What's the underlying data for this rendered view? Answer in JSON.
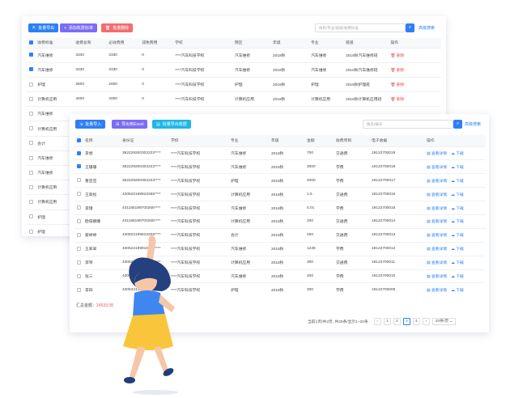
{
  "back": {
    "buttons": [
      "批量导出",
      "添加收费标准",
      "批量删除"
    ],
    "search_placeholder": "按校/专业/班级/收费标准",
    "advanced_search": "高级搜索",
    "columns": [
      "收费标准",
      "收费总和",
      "必收费用",
      "减免费用",
      "学校",
      "院区",
      "年级",
      "专业",
      "班级",
      "操作"
    ],
    "delete_label": "删除",
    "rows": [
      {
        "checked": true,
        "cells": [
          "汽车维修",
          "3330",
          "3330",
          "0",
          "****汽车科技学校",
          "汽车维修",
          "2018秋",
          "汽车维修",
          "2018秋汽车维修班"
        ]
      },
      {
        "checked": true,
        "cells": [
          "汽车维修",
          "3330",
          "3330",
          "0",
          "****汽车科技学校",
          "汽车维修",
          "2018秋",
          "汽车维修",
          "2018秋汽车维修班"
        ]
      },
      {
        "checked": false,
        "cells": [
          "护理",
          "2600",
          "2600",
          "0",
          "****汽车科技学校",
          "护理",
          "2018秋",
          "护理",
          "2018秋护理班"
        ]
      },
      {
        "checked": false,
        "cells": [
          "计算机应用",
          "4000",
          "4000",
          "0",
          "****汽车科技学校",
          "计算机应用",
          "2018秋",
          "计算机应用",
          "2018秋计算机应用班"
        ]
      },
      {
        "checked": false,
        "cells": [
          "汽车维修",
          "",
          "",
          "",
          "",
          "",
          "",
          "",
          ""
        ]
      },
      {
        "checked": false,
        "cells": [
          "计算机应用",
          "",
          "",
          "",
          "",
          "",
          "",
          "",
          ""
        ]
      },
      {
        "checked": false,
        "cells": [
          "会计",
          "",
          "",
          "",
          "",
          "",
          "",
          "",
          ""
        ]
      },
      {
        "checked": false,
        "cells": [
          "汽车维修",
          "",
          "",
          "",
          "",
          "",
          "",
          "",
          ""
        ]
      },
      {
        "checked": false,
        "cells": [
          "汽车维修",
          "",
          "",
          "",
          "",
          "",
          "",
          "",
          ""
        ]
      },
      {
        "checked": false,
        "cells": [
          "计算机应用",
          "",
          "",
          "",
          "",
          "",
          "",
          "",
          ""
        ]
      },
      {
        "checked": false,
        "cells": [
          "计算机应用",
          "",
          "",
          "",
          "",
          "",
          "",
          "",
          ""
        ]
      },
      {
        "checked": false,
        "cells": [
          "护理",
          "",
          "",
          "",
          "",
          "",
          "",
          "",
          ""
        ]
      },
      {
        "checked": false,
        "cells": [
          "护理",
          "",
          "",
          "",
          "",
          "",
          "",
          "",
          ""
        ]
      }
    ]
  },
  "front": {
    "buttons": [
      "批量导入",
      "导出到Excel",
      "批量导出收据"
    ],
    "search_placeholder": "搜名/编号",
    "advanced_search": "高级搜索",
    "columns": [
      "名称",
      "身份证",
      "学校",
      "专业",
      "年级",
      "金额",
      "收费项目",
      "电子收据",
      "操作"
    ],
    "view_label": "查看详情",
    "download_label": "下载",
    "rows": [
      {
        "checked": true,
        "cells": [
          "李想",
          "362229200302223****",
          "****汽车科技学校",
          "汽车维修",
          "2018秋",
          "700",
          "交通费",
          "19122700019"
        ]
      },
      {
        "checked": true,
        "cells": [
          "王珊珊",
          "362229200302223****",
          "****汽车科技学校",
          "汽车维修",
          "2018秋",
          "3000",
          "学费",
          "19122700018"
        ]
      },
      {
        "checked": false,
        "cells": [
          "曹宣宣",
          "362229200302223****",
          "****汽车科技学校",
          "护理",
          "2018秋",
          "4000",
          "学费",
          "19122700017"
        ]
      },
      {
        "checked": false,
        "cells": [
          "王家松",
          "430522199810255****",
          "****汽车科技学校",
          "计算机应用",
          "2018秋",
          "1.5",
          "交通费",
          "19122700016"
        ]
      },
      {
        "checked": false,
        "cells": [
          "李瑾",
          "431188199700265****",
          "****汽车科技学校",
          "汽车维修",
          "2018秋",
          "0.01",
          "学费",
          "19122700015"
        ]
      },
      {
        "checked": false,
        "cells": [
          "欧阳娜娜",
          "431188199700265****",
          "****汽车科技学校",
          "计算机应用",
          "2018秋",
          "200",
          "交通费",
          "19122700014"
        ]
      },
      {
        "checked": false,
        "cells": [
          "蔡婷婷",
          "430522199810255****",
          "****汽车科技学校",
          "会计",
          "2018秋",
          "450",
          "交通费",
          "19122700013"
        ]
      },
      {
        "checked": false,
        "cells": [
          "王翠翠",
          "430522199810255****",
          "****汽车科技学校",
          "汽车维修",
          "2018秋",
          "1235",
          "学费",
          "19122700012"
        ]
      },
      {
        "checked": false,
        "cells": [
          "李琴",
          "430522199810255****",
          "****汽车科技学校",
          "计算机应用",
          "2018秋",
          "300",
          "交通费",
          "19122700011"
        ]
      },
      {
        "checked": false,
        "cells": [
          "张三",
          "430522199810255****",
          "****汽车科技学校",
          "汽车维修",
          "2018秋",
          "400",
          "学费",
          "19122700010"
        ]
      },
      {
        "checked": false,
        "cells": [
          "李四",
          "430522199810255****",
          "****汽车科技学校",
          "护理",
          "2018秋",
          "300",
          "学费",
          "19122700009"
        ]
      }
    ],
    "total_label": "汇总金额：",
    "total_value": "24533.08",
    "pagination": {
      "summary": "当前1页/共2页, 共30条/显示1~20条",
      "pages": [
        "1",
        "2",
        "3",
        "4"
      ],
      "current": "3",
      "page_size": "20条/页"
    }
  },
  "colors": {
    "primary": "#2d7ff9",
    "purple": "#7b6cf6",
    "red": "#f26d6d",
    "cyan": "#1fb6e8",
    "danger": "#e55555"
  }
}
